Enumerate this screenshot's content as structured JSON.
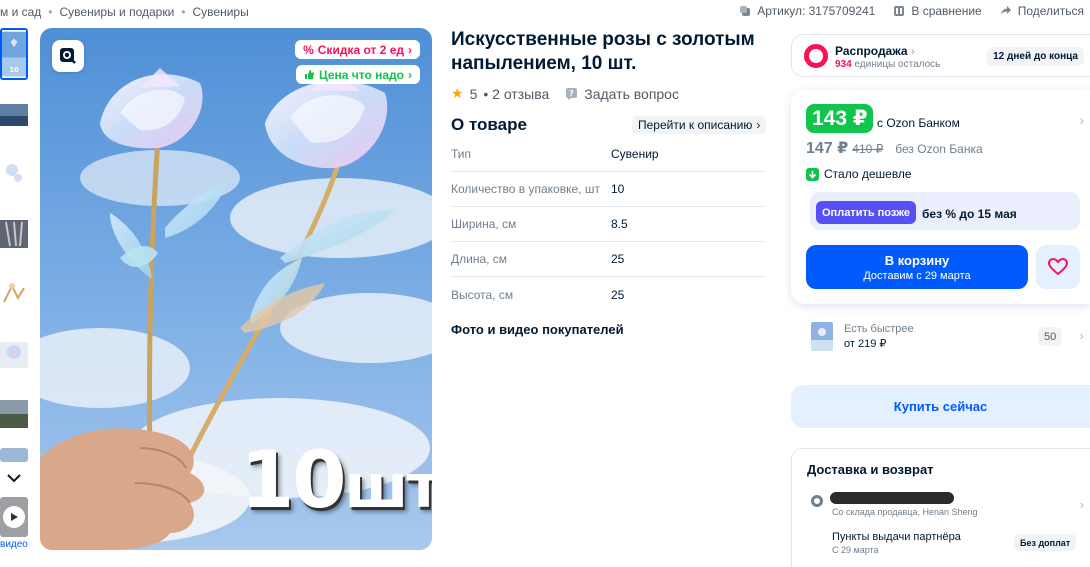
{
  "breadcrumbs": [
    "м и сад",
    "Сувениры и подарки",
    "Сувениры"
  ],
  "top_actions": {
    "article": "Артикул: 3175709241",
    "compare": "В сравнение",
    "share": "Поделиться"
  },
  "gallery": {
    "video_label": "видео",
    "badge_discount": "Скидка от 2 ед",
    "badge_price": "Цена что надо",
    "overlay_number": "10",
    "overlay_unit": "шт"
  },
  "product": {
    "title": "Искусственные розы с золотым напылением, 10 шт.",
    "rating": "5",
    "reviews": "• 2 отзыва",
    "ask": "Задать вопрос"
  },
  "about": {
    "heading": "О товаре",
    "goto": "Перейти к описанию",
    "specs": [
      {
        "k": "Тип",
        "v": "Сувенир"
      },
      {
        "k": "Количество в упаковке, шт",
        "v": "10"
      },
      {
        "k": "Ширина, см",
        "v": "8.5"
      },
      {
        "k": "Длина, см",
        "v": "25"
      },
      {
        "k": "Высота, см",
        "v": "25"
      }
    ],
    "photos_heading": "Фото и видео покупателей"
  },
  "sale": {
    "title": "Распродажа",
    "count": "934",
    "count_suffix": "единицы осталось",
    "days": "12 дней до конца"
  },
  "price": {
    "card_price": "143 ₽",
    "card_label": "с Ozon Банком",
    "regular_price": "147 ₽",
    "old_price": "410 ₽",
    "regular_label": "без Ozon Банка",
    "cheaper": "Стало дешевле",
    "pay_later_btn": "Оплатить позже",
    "pay_later_text": "без % до 15 мая",
    "cart_label": "В корзину",
    "cart_sub": "Доставим с 29 марта"
  },
  "faster": {
    "title": "Есть быстрее",
    "price": "от 219 ₽",
    "count": "50"
  },
  "buy_now": "Купить сейчас",
  "delivery": {
    "heading": "Доставка и возврат",
    "address_sub": "Со склада продавца, Henan Sheng",
    "pvz_title": "Пункты выдачи партнёра",
    "pvz_date": "С 29 марта",
    "pvz_badge": "Без доплат"
  },
  "colors": {
    "accent": "#005bff",
    "green": "#10c44c",
    "pink": "#f91155",
    "purple": "#5650f5"
  }
}
